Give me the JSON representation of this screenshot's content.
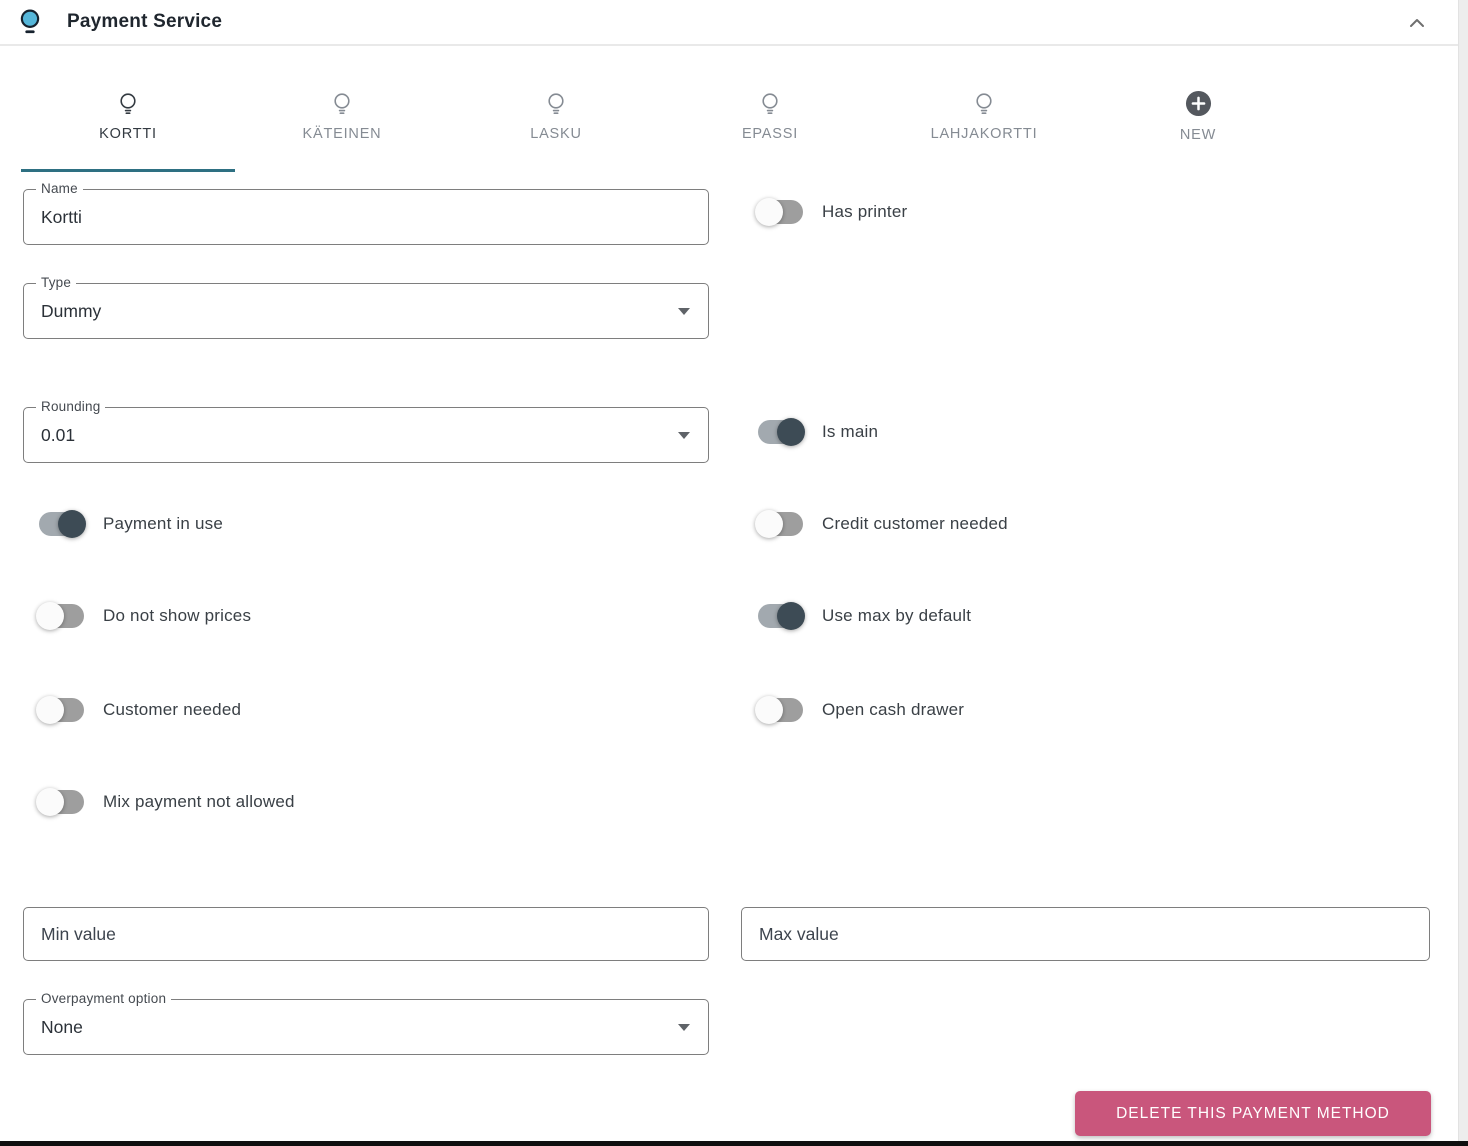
{
  "header": {
    "title": "Payment Service"
  },
  "tabs": [
    {
      "label": "KORTTI",
      "icon": "lightbulb",
      "active": true
    },
    {
      "label": "KÄTEINEN",
      "icon": "lightbulb",
      "active": false
    },
    {
      "label": "LASKU",
      "icon": "lightbulb",
      "active": false
    },
    {
      "label": "EPASSI",
      "icon": "lightbulb",
      "active": false
    },
    {
      "label": "LAHJAKORTTI",
      "icon": "lightbulb",
      "active": false
    },
    {
      "label": "NEW",
      "icon": "plus-circle",
      "active": false
    }
  ],
  "form": {
    "name": {
      "label": "Name",
      "value": "Kortti"
    },
    "type": {
      "label": "Type",
      "value": "Dummy"
    },
    "rounding": {
      "label": "Rounding",
      "value": "0.01"
    },
    "toggles": {
      "has_printer": {
        "label": "Has printer",
        "on": false
      },
      "is_main": {
        "label": "Is main",
        "on": true
      },
      "payment_in_use": {
        "label": "Payment in use",
        "on": true
      },
      "credit_customer_needed": {
        "label": "Credit customer needed",
        "on": false
      },
      "do_not_show_prices": {
        "label": "Do not show prices",
        "on": false
      },
      "use_max_by_default": {
        "label": "Use max by default",
        "on": true
      },
      "customer_needed": {
        "label": "Customer needed",
        "on": false
      },
      "open_cash_drawer": {
        "label": "Open cash drawer",
        "on": false
      },
      "mix_payment_not_allowed": {
        "label": "Mix payment not allowed",
        "on": false
      }
    },
    "min_value": {
      "placeholder": "Min value"
    },
    "max_value": {
      "placeholder": "Max value"
    },
    "overpayment": {
      "label": "Overpayment option",
      "value": "None"
    },
    "delete_button_label": "DELETE THIS PAYMENT METHOD"
  },
  "colors": {
    "accent_teal": "#2e7082",
    "danger_pink": "#c9567c",
    "toggle_on_thumb": "#3d4b55",
    "bulb_blue": "#56b7da",
    "inactive_tab": "#858b93"
  }
}
